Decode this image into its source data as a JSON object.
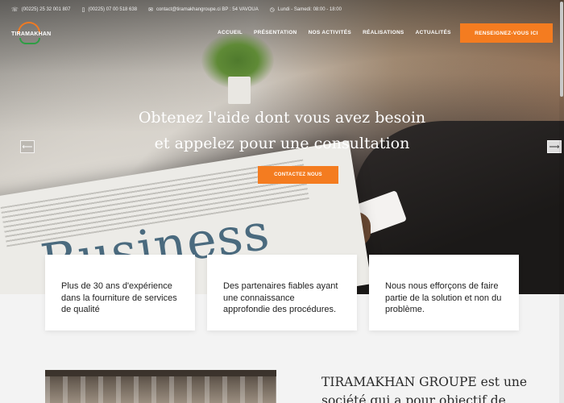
{
  "topbar": {
    "phone1": "(00225) 25 32 001 807",
    "phone2": "(00225) 07 00 518 638",
    "email": "contact@tiramakhangroupe.ci BP : 54 VAVOUA",
    "hours": "Lundi - Samedi: 08:00 - 18:00"
  },
  "brand": {
    "name": "TIRAMAKHAN",
    "accent": "#f47c20",
    "secondary": "#2e9d44"
  },
  "nav": {
    "items": [
      "ACCUEIL",
      "PRÉSENTATION",
      "NOS ACTIVITÉS",
      "RÉALISATIONS",
      "ACTUALITÉS"
    ],
    "cta": "RENSEIGNEZ-VOUS ICI"
  },
  "hero": {
    "line1": "Obtenez l'aide dont vous avez besoin",
    "line2": "et appelez pour une consultation",
    "cta": "CONTACTEZ NOUS",
    "image_word": "Business",
    "prev_icon": "arrow-left-icon",
    "next_icon": "arrow-right-icon"
  },
  "features": [
    "Plus de 30 ans d'expérience dans la fourniture de services de qualité",
    "Des partenaires fiables ayant une connaissance approfondie des procédures.",
    "Nous nous efforçons de faire partie de la solution et non du problème."
  ],
  "about": {
    "text": "TIRAMAKHAN GROUPE est une société qui a pour objectif de"
  }
}
